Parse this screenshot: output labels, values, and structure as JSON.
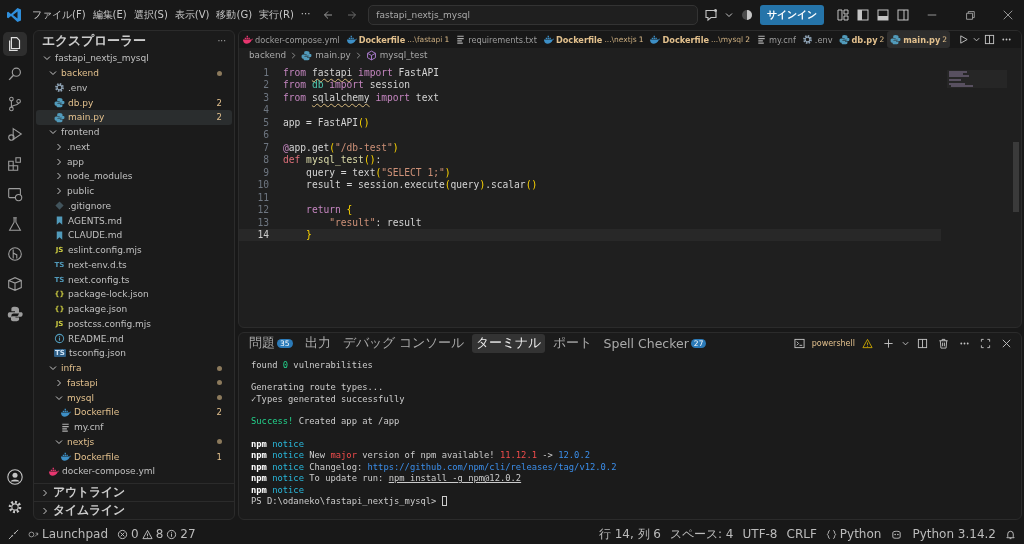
{
  "titlebar": {
    "menu": [
      "ファイル(F)",
      "編集(E)",
      "選択(S)",
      "表示(V)",
      "移動(G)",
      "実行(R)",
      "···"
    ],
    "search": "fastapi_nextjs_mysql",
    "signin": "サインイン"
  },
  "activity_bar": [
    {
      "kind": "files",
      "selected": true
    },
    {
      "kind": "search",
      "selected": false
    },
    {
      "kind": "scm",
      "selected": false
    },
    {
      "kind": "debug",
      "selected": false
    },
    {
      "kind": "extensions",
      "selected": false
    },
    {
      "kind": "remote",
      "selected": false
    },
    {
      "kind": "testing",
      "selected": false
    },
    {
      "kind": "graph",
      "selected": false
    },
    {
      "kind": "box",
      "selected": false
    },
    {
      "kind": "python",
      "selected": false
    }
  ],
  "explorer": {
    "title": "エクスプローラー",
    "more": "···",
    "root": {
      "name": "fastapi_nextjs_mysql",
      "kind": "folder",
      "expanded": true,
      "selected": false,
      "children": [
        {
          "name": "backend",
          "kind": "folder",
          "expanded": true,
          "modified": true,
          "selected": false,
          "children": [
            {
              "name": ".env",
              "kind": "gear",
              "modified": false,
              "selected": false
            },
            {
              "name": "db.py",
              "kind": "python",
              "modified": true,
              "selected": false,
              "badge": "2"
            },
            {
              "name": "main.py",
              "kind": "python",
              "modified": true,
              "selected": true,
              "badge": "2"
            }
          ]
        },
        {
          "name": "frontend",
          "kind": "folder",
          "expanded": true,
          "modified": false,
          "selected": false,
          "children": [
            {
              "name": ".next",
              "kind": "folder",
              "expanded": false,
              "modified": false,
              "selected": false
            },
            {
              "name": "app",
              "kind": "folder",
              "expanded": false,
              "modified": false,
              "selected": false
            },
            {
              "name": "node_modules",
              "kind": "folder",
              "expanded": false,
              "modified": false,
              "selected": false
            },
            {
              "name": "public",
              "kind": "folder",
              "expanded": false,
              "modified": false,
              "selected": false
            },
            {
              "name": ".gitignore",
              "kind": "git",
              "modified": false,
              "selected": false
            },
            {
              "name": "AGENTS.md",
              "kind": "markdown",
              "modified": false,
              "selected": false
            },
            {
              "name": "CLAUDE.md",
              "kind": "markdown",
              "modified": false,
              "selected": false
            },
            {
              "name": "eslint.config.mjs",
              "kind": "js",
              "icon_text": "JS",
              "modified": false,
              "selected": false
            },
            {
              "name": "next-env.d.ts",
              "kind": "ts",
              "icon_text": "TS",
              "modified": false,
              "selected": false
            },
            {
              "name": "next.config.ts",
              "kind": "ts",
              "icon_text": "TS",
              "modified": false,
              "selected": false
            },
            {
              "name": "package-lock.json",
              "kind": "json",
              "icon_text": "{}",
              "modified": false,
              "selected": false
            },
            {
              "name": "package.json",
              "kind": "json",
              "icon_text": "{}",
              "modified": false,
              "selected": false
            },
            {
              "name": "postcss.config.mjs",
              "kind": "js",
              "icon_text": "JS",
              "modified": false,
              "selected": false
            },
            {
              "name": "README.md",
              "kind": "info",
              "modified": false,
              "selected": false
            },
            {
              "name": "tsconfig.json",
              "kind": "tsconfig",
              "icon_text": "TS",
              "modified": false,
              "selected": false
            }
          ]
        },
        {
          "name": "infra",
          "kind": "folder",
          "expanded": true,
          "modified": true,
          "selected": false,
          "children": [
            {
              "name": "fastapi",
              "kind": "folder",
              "expanded": false,
              "modified": true,
              "selected": false
            },
            {
              "name": "mysql",
              "kind": "folder",
              "expanded": true,
              "modified": true,
              "selected": false,
              "children": [
                {
                  "name": "Dockerfile",
                  "kind": "docker",
                  "modified": true,
                  "selected": false,
                  "badge": "2"
                },
                {
                  "name": "my.cnf",
                  "kind": "lines",
                  "modified": false,
                  "selected": false
                }
              ]
            },
            {
              "name": "nextjs",
              "kind": "folder",
              "expanded": true,
              "modified": true,
              "selected": false,
              "children": [
                {
                  "name": "Dockerfile",
                  "kind": "docker",
                  "modified": true,
                  "selected": false,
                  "badge": "1"
                }
              ]
            }
          ]
        },
        {
          "name": "docker-compose.yml",
          "kind": "compose",
          "modified": false,
          "selected": false
        }
      ]
    },
    "sections": [
      {
        "label": "アウトライン",
        "expanded": false
      },
      {
        "label": "タイムライン",
        "expanded": false
      }
    ]
  },
  "tabs": [
    {
      "label": "docker-compose.yml",
      "kind": "compose",
      "modified": false,
      "selected": false
    },
    {
      "label": "Dockerfile",
      "description": "...\\fastapi",
      "badge": "1",
      "kind": "docker",
      "modified": true,
      "selected": false
    },
    {
      "label": "requirements.txt",
      "kind": "lines",
      "modified": false,
      "selected": false
    },
    {
      "label": "Dockerfile",
      "description": "...\\nextjs",
      "badge": "1",
      "kind": "docker",
      "modified": true,
      "selected": false
    },
    {
      "label": "Dockerfile",
      "description": "...\\mysql",
      "badge": "2",
      "kind": "docker",
      "modified": true,
      "selected": false
    },
    {
      "label": "my.cnf",
      "kind": "lines",
      "modified": false,
      "selected": false
    },
    {
      "label": ".env",
      "kind": "gear",
      "modified": false,
      "selected": false
    },
    {
      "label": "db.py",
      "badge": "2",
      "kind": "python",
      "modified": true,
      "selected": false
    },
    {
      "label": "main.py",
      "badge": "2",
      "kind": "python",
      "modified": true,
      "selected": true
    }
  ],
  "breadcrumbs": [
    {
      "label": "backend",
      "kind": "folder"
    },
    {
      "label": "main.py",
      "kind": "python"
    },
    {
      "label": "mysql_test",
      "kind": "function"
    }
  ],
  "code": [
    {
      "number": "1",
      "current": false,
      "tokens": [
        {
          "text": "from ",
          "kind": "kw"
        },
        {
          "text": "fastapi",
          "kind": "plain",
          "warn": true
        },
        {
          "text": " import",
          "kind": "kw"
        },
        {
          "text": " FastAPI"
        }
      ]
    },
    {
      "number": "2",
      "current": false,
      "tokens": [
        {
          "text": "from",
          "kind": "kw"
        },
        {
          "text": " db",
          "kind": "mod"
        },
        {
          "text": " import",
          "kind": "kw"
        },
        {
          "text": " session"
        }
      ]
    },
    {
      "number": "3",
      "current": false,
      "tokens": [
        {
          "text": "from ",
          "kind": "kw"
        },
        {
          "text": "sqlalchemy",
          "kind": "plain",
          "warn": true
        },
        {
          "text": " import",
          "kind": "kw"
        },
        {
          "text": " text"
        }
      ]
    },
    {
      "number": "4",
      "current": false
    },
    {
      "number": "5",
      "current": false,
      "tokens": [
        {
          "text": "app = FastAPI"
        },
        {
          "text": "()",
          "kind": "brk"
        }
      ]
    },
    {
      "number": "6",
      "current": false
    },
    {
      "number": "7",
      "current": false,
      "tokens": [
        {
          "text": "@",
          "kind": "kw"
        },
        {
          "text": "app.get"
        },
        {
          "text": "(",
          "kind": "brk"
        },
        {
          "text": "\"/db-test\"",
          "kind": "str"
        },
        {
          "text": ")",
          "kind": "brk"
        }
      ]
    },
    {
      "number": "8",
      "current": false,
      "tokens": [
        {
          "text": "def",
          "kind": "def"
        },
        {
          "text": " mysql_test",
          "kind": "fn"
        },
        {
          "text": "()",
          "kind": "brk"
        },
        {
          "text": ":"
        }
      ]
    },
    {
      "number": "9",
      "current": false,
      "tokens": [
        {
          "text": "    query = text"
        },
        {
          "text": "(",
          "kind": "brk"
        },
        {
          "text": "\"SELECT 1;\"",
          "kind": "str"
        },
        {
          "text": ")",
          "kind": "brk"
        }
      ]
    },
    {
      "number": "10",
      "current": false,
      "tokens": [
        {
          "text": "    result = session.execute"
        },
        {
          "text": "(",
          "kind": "brk"
        },
        {
          "text": "query"
        },
        {
          "text": ")",
          "kind": "brk"
        },
        {
          "text": ".scalar"
        },
        {
          "text": "()",
          "kind": "brk"
        }
      ]
    },
    {
      "number": "11",
      "current": false
    },
    {
      "number": "12",
      "current": false,
      "tokens": [
        {
          "text": "    return",
          "kind": "kw"
        },
        {
          "text": " {",
          "kind": "brk"
        }
      ]
    },
    {
      "number": "13",
      "current": false,
      "tokens": [
        {
          "text": "        \"result\"",
          "kind": "str"
        },
        {
          "text": ": result"
        }
      ]
    },
    {
      "number": "14",
      "current": true,
      "tokens": [
        {
          "text": "    }",
          "kind": "brk"
        }
      ]
    }
  ],
  "panel": {
    "tabs": [
      {
        "label": "問題",
        "badge": "35",
        "selected": false
      },
      {
        "label": "出力",
        "selected": false
      },
      {
        "label": "デバッグ コンソール",
        "selected": false
      },
      {
        "label": "ターミナル",
        "selected": true
      },
      {
        "label": "ポート",
        "selected": false
      },
      {
        "label": "Spell Checker",
        "badge": "27",
        "selected": false
      }
    ],
    "shell": "powershell",
    "terminal": [
      {
        "lines": [
          [
            {
              "text": "found "
            },
            {
              "text": "0",
              "kind": "green"
            },
            {
              "text": " vulnerabilities"
            }
          ]
        ]
      },
      {
        "lines": [
          [
            {
              "text": "Generating route types..."
            }
          ],
          [
            {
              "text": "✓Types generated successfully"
            }
          ]
        ]
      },
      {
        "lines": [
          [
            {
              "text": "Success!",
              "kind": "green"
            },
            {
              "text": " Created app at /app"
            }
          ]
        ]
      },
      {
        "lines": [
          [
            {
              "text": "npm",
              "kind": "bold"
            },
            {
              "text": " notice",
              "kind": "cyan"
            }
          ],
          [
            {
              "text": "npm",
              "kind": "bold"
            },
            {
              "text": " notice",
              "kind": "cyan"
            },
            {
              "text": " New "
            },
            {
              "text": "major",
              "kind": "red"
            },
            {
              "text": " version of npm available! "
            },
            {
              "text": "11.12.1",
              "kind": "red"
            },
            {
              "text": " -> "
            },
            {
              "text": "12.0.2",
              "kind": "blue"
            }
          ],
          [
            {
              "text": "npm",
              "kind": "bold"
            },
            {
              "text": " notice",
              "kind": "cyan"
            },
            {
              "text": " Changelog: "
            },
            {
              "text": "https://github.com/npm/cli/releases/tag/v12.0.2",
              "kind": "blue"
            }
          ],
          [
            {
              "text": "npm",
              "kind": "bold"
            },
            {
              "text": " notice",
              "kind": "cyan"
            },
            {
              "text": " To update run: "
            },
            {
              "text": "npm install -g npm@12.0.2",
              "kind": "underline"
            }
          ],
          [
            {
              "text": "npm",
              "kind": "bold"
            },
            {
              "text": " notice",
              "kind": "cyan"
            }
          ],
          [
            {
              "text": "PS D:\\odaneko\\fastapi_nextjs_mysql> "
            }
          ]
        ]
      }
    ]
  },
  "status_bar": {
    "launchpad": "Launchpad",
    "errors": "0",
    "warnings": "8",
    "infos": "27",
    "position": "行 14, 列 6",
    "spaces": "スペース: 4",
    "encoding": "UTF-8",
    "eol": "CRLF",
    "language": "Python",
    "interpreter": "Python 3.14.2"
  }
}
